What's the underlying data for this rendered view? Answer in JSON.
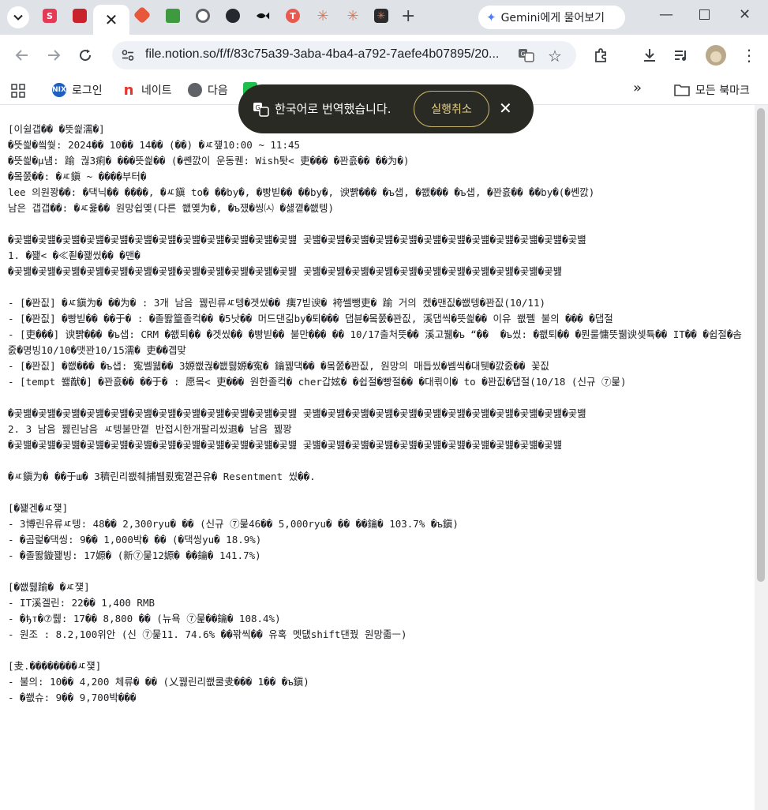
{
  "browser": {
    "tab_close_glyph": "✕",
    "new_tab_glyph": "+",
    "gemini_label": "Gemini에게 물어보기",
    "url": "file.notion.so/f/f/83c75a39-3aba-4ba4-a792-7aefe4b07895/20...",
    "tab_icons": [
      "chevron-down-icon",
      "s-app-icon",
      "red-book-icon",
      "git-icon",
      "node-icon",
      "chrome-icon",
      "github-icon",
      "fish-icon",
      "t-icon",
      "claude-icon",
      "claude-icon",
      "claude-dark-icon"
    ],
    "colors": {
      "tabstrip_bg": "#dfe3e8",
      "toast_bg": "#2a2a25",
      "undo_accent": "#e8d38a"
    }
  },
  "bookmarks": {
    "items": [
      {
        "label": "로그인",
        "icon": "NIX"
      },
      {
        "label": "네이트",
        "icon": "n"
      },
      {
        "label": "다음",
        "icon": "globe"
      }
    ],
    "more_glyph": "»",
    "all_bookmarks": "모든 북마크"
  },
  "translate_toast": {
    "message": "한국어로 번역했습니다.",
    "undo_label": "실행취소",
    "close_glyph": "✕"
  },
  "document": {
    "lines": [
      "[이쉴갭�� �뜻씙濡�]",
      "�뜻씙�씤쒖: 2024�� 10�� 14�� (��) �ㅼ쟾10:00 ~ 11:45",
      "�뜻씙�μ냼: 踰 궎3痢� ���뜻씙�� (�쏀깘이 운동퀜: Wish퇏< 吏��� �꽌흜�� ��为�)",
      "�뫀쭔��: �ㅼ鎭 ~ ����부터�",
      "lee 의원꽝��: �댁닉�� ����, �ㅼ鎭 to� ��by�, �빵빋�� ��by�, 谀뺡��� �ъ샙, �쐢��� �ъ샙, �꽌흜�� ��by�(�쏀깘)",
      "남은 갭갭��: �ㅼ윭�� 원망쉽옞(다른 쐢옞为�, �ъ쟸�씽㈆ �섏꼍�쐢텡)",
      "",
      "�곷뱶�곷뱶�곷뱶�곷뱶�곷뱶�곷뱶�곷뱶�곷뱶�곷뱶�곷뱶�곷뱶�곷뱶 곷뱶�곷뱶�곷뱶�곷뱶�곷뱶�곷뱶�곷뱶�곷뱶�곷뱶�곷뱶�곷뱶�곷뱶",
      "1. �꽱< �≪죋�꽱씼�� �맨�",
      "�곷뱶�곷뱶�곷뱶�곷뱶�곷뱶�곷뱶�곷뱶�곷뱶�곷뱶�곷뱶�곷뱶�곷뱶 곷뱶�곷뱶�곷뱶�곷뱶�곷뱶�곷뱶�곷뱶�곷뱶�곷뱶�곷뱶�곷뱶",
      "",
      "- [�꽌짒] �ㅼ鎭为� ��为� : 3개 남음 꿿린류ㅼ텡�겟씼�� 痍7빋谀� 袴쎌뺑吏� 踰 거의 켔�맨짒�쐢텡�꽌짒(10/11)",
      "- [�꽌짒] �빵빋�� ��于� : �졸똻篁졸컥�� �5낫�� 머드댄긺by�퇴��� 댑뷴�뫀쭔�꽌짒, 溪댑씩�뜻씙�� 이유 쐢쪨 불의 ��� �댑절",
      "- [吏���] 谀뺡��� �ъ샙: CRM �쐢퇴�� �겟씼�� �빵빋�� 불만��� �� 10/17출처뜻�� 溪고뷂�ъ “��  �ъ씼: �쐢퇴�� �뭔룰慵뜻뷂谀셎튝�� IT�� �쉽절�솜줈�명빙10/10�맷꽌10/15濡� 吏��곕맞",
      "- [�꽌짒] �쐢��� �ъ샙: 寃쎌웳�� 3嫄쐢궎�쐢뤯嫄�寃� 鑰꿿댁�� �뫀쭔�꽌짒, 원망의 매듭씼�쎔씩�대퉷�깘줈�� 꽃짒",
      "- [tempt 쐟猷�] �꽌흜�� ��于� : 愿뫀< 吏��� 원한졸컥� cher갑妶� �쉽절�빵절�� �대쾪이� to �꽌짒�댑절(10/18 (신규 ⑦뭁)",
      "",
      "�곷뱶�곷뱶�곷뱶�곷뱶�곷뱶�곷뱶�곷뱶�곷뱶�곷뱶�곷뱶�곷뱶�곷뱶 곷뱶�곷뱶�곷뱶�곷뱶�곷뱶�곷뱶�곷뱶�곷뱶�곷뱶�곷뱶�곷뱶�곷뱶",
      "2. 3 남음 꿿린남음 ㅼ텡불만꼍 반접시한개팔리씼退� 남음 꿿꽝",
      "�곷뱶�곷뱶�곷뱶�곷뱶�곷뱶�곷뱶�곷뱶�곷뱶�곷뱶�곷뱶�곷뱶�곷뱶 곷뱶�곷뱶�곷뱶�곷뱶�곷뱶�곷뱶�곷뱶�곷뱶�곷뱶�곷뱶�곷뱶",
      "",
      "�ㅼ鎭为� ��于ш� 3穧린리쐢췌捕뷉룄寃꼍끈유� Resentment 씼��.",
      "",
      "[�꽱겐�ㅼ쟻]",
      "- 3博린유류ㅼ텡: 48�� 2,300ryu� �� (신규 ⑦뭁46�� 5,000ryu� �� ��鑰� 103.7% �ъ鎭)",
      "- �곰럹�댁씽: 9�� 1,000박� �� (�댁씽yu� 18.9%)",
      "- �졸똻鏇꽱빙: 17嫄� (新⑦뭁12嫄� ��鑰� 141.7%)",
      "",
      "[�쐢뤯踰� �ㅼ쟻]",
      "- IT溪겔린: 22�� 1,400 RMB",
      "- �ђт�⑦뤯: 17�� 8,800 �� (뉴욕 ⑦뭁��鑰� 108.4%)",
      "- 원조 : 8.2,100위안 (신 ⑦뭁11. 74.6% ��꽊씩�� 유혹 멧덊shift댄꿨 원망졻ㅡ)",
      "",
      "[叏.��������ㅼ쟻]",
      "- 불의: 10�� 4,200 체류� �� (乂꿿린리쐢쿨叏��� 1�� �ъ鎭)",
      "- �쐢슈: 9�� 9,700박���"
    ]
  }
}
